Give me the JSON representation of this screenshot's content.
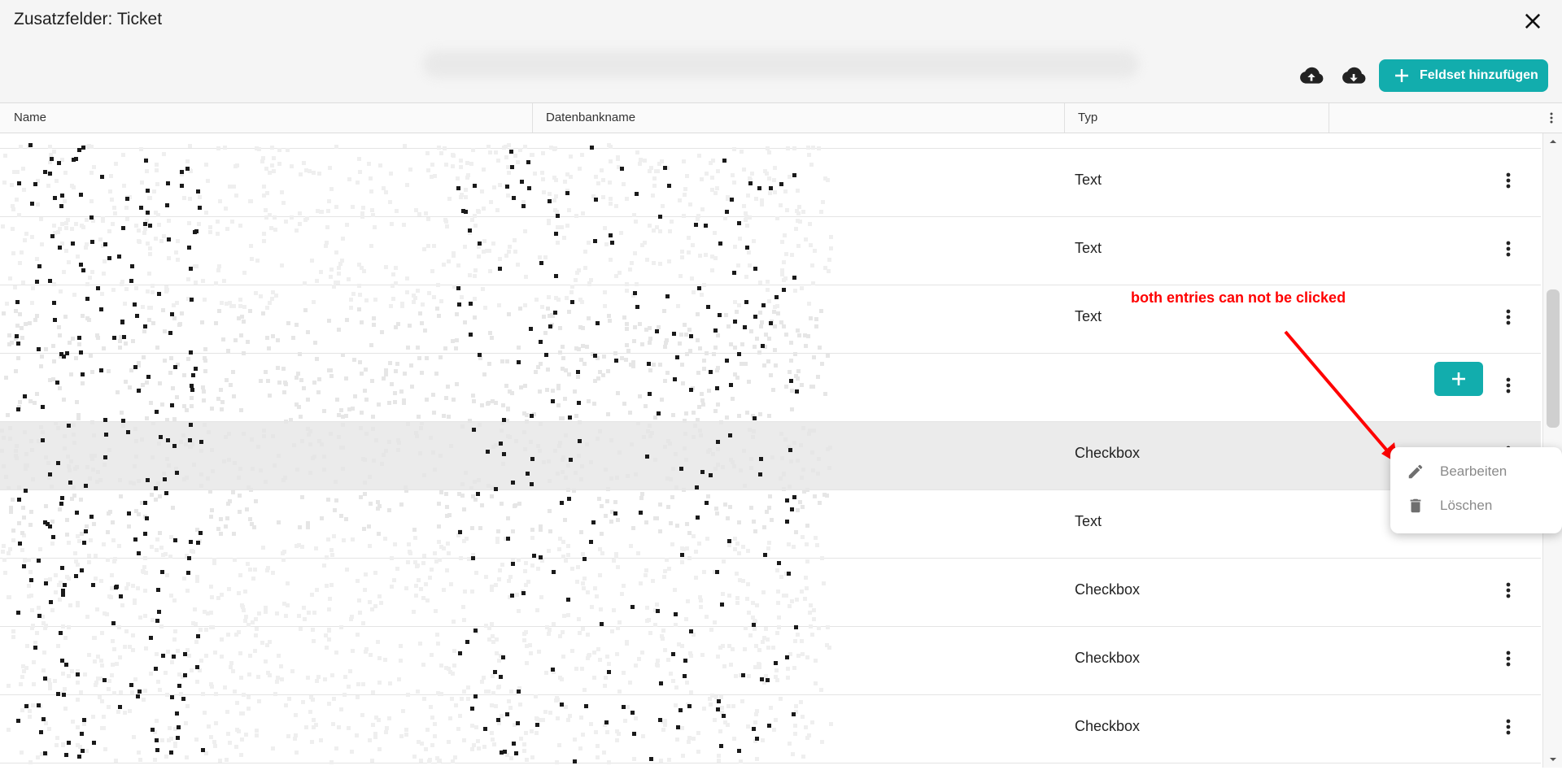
{
  "window": {
    "title": "Zusatzfelder: Ticket",
    "close_icon": "close-icon"
  },
  "toolbar": {
    "upload_icon": "cloud-upload-icon",
    "download_icon": "cloud-download-icon",
    "add_fieldset_label": "Feldset hinzufügen",
    "accent_color": "#12adad"
  },
  "table": {
    "columns": [
      "Name",
      "Datenbankname",
      "Typ"
    ],
    "rows": [
      {
        "type": "Text"
      },
      {
        "type": "Text"
      },
      {
        "type": "Text"
      },
      {
        "type": ""
      },
      {
        "type": "Checkbox",
        "highlighted": true
      },
      {
        "type": "Text"
      },
      {
        "type": "Checkbox"
      },
      {
        "type": "Checkbox"
      },
      {
        "type": "Checkbox"
      }
    ]
  },
  "context_menu": {
    "items": [
      {
        "label": "Bearbeiten",
        "icon": "pencil-icon"
      },
      {
        "label": "Löschen",
        "icon": "trash-icon"
      }
    ]
  },
  "annotation": {
    "text": "both entries can not be clicked",
    "color": "#ff0000"
  }
}
